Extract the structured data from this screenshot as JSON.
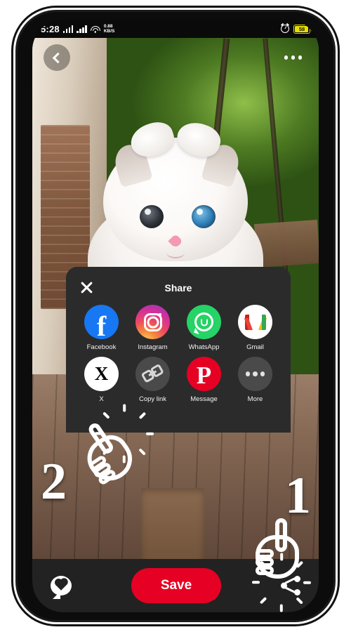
{
  "status_bar": {
    "time": "5:28",
    "network_speed": "0.88",
    "network_speed_unit": "KB/S",
    "battery_percent": "58",
    "icons": [
      "signal-bars-sim1",
      "signal-bars-sim2",
      "wifi-icon",
      "alarm-icon",
      "battery-icon"
    ]
  },
  "top_nav": {
    "back_icon": "chevron-left-icon",
    "more_icon": "three-dots-menu-icon"
  },
  "photo": {
    "alt": "White fluffy cat with a white bow and heterochromia eyes sitting in a wooden planter on a porch"
  },
  "share_sheet": {
    "title": "Share",
    "close_icon": "close-x-icon",
    "apps": [
      {
        "label": "Facebook",
        "icon": "facebook-icon",
        "color": "#1877f2"
      },
      {
        "label": "Instagram",
        "icon": "instagram-icon",
        "color": "#d6309a"
      },
      {
        "label": "WhatsApp",
        "icon": "whatsapp-icon",
        "color": "#25d366"
      },
      {
        "label": "Gmail",
        "icon": "gmail-icon",
        "color": "#ffffff"
      },
      {
        "label": "X",
        "icon": "x-twitter-icon",
        "color": "#ffffff"
      },
      {
        "label": "Copy link",
        "icon": "link-chain-icon",
        "color": "#4a4a4a"
      },
      {
        "label": "Message",
        "icon": "pinterest-icon",
        "color": "#e60023"
      },
      {
        "label": "More",
        "icon": "more-dots-icon",
        "color": "#4a4a4a"
      }
    ]
  },
  "bottom_bar": {
    "comment_icon": "heart-speech-bubble-icon",
    "save_label": "Save",
    "save_color": "#e60023",
    "share_icon": "share-nodes-icon"
  },
  "steps": [
    {
      "number": "1",
      "pointer_icon": "tap-hand-icon",
      "target": "share-nodes-icon"
    },
    {
      "number": "2",
      "pointer_icon": "tap-hand-icon",
      "target": "copy-link-button"
    }
  ]
}
